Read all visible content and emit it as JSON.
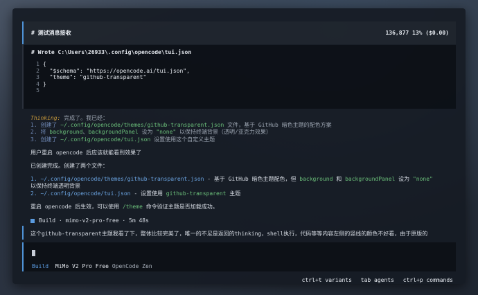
{
  "header": {
    "title": "# 测试消息接收",
    "stats": "136,877  13% ($0.00)"
  },
  "tool": {
    "title": "# Wrote C:\\Users\\26933\\.config\\opencode\\tui.json",
    "lines": [
      {
        "num": "1",
        "text": "{"
      },
      {
        "num": "2",
        "text": "  \"$schema\": \"https://opencode.ai/tui.json\","
      },
      {
        "num": "3",
        "text": "  \"theme\": \"github-transparent\""
      },
      {
        "num": "4",
        "text": "}"
      },
      {
        "num": "5",
        "text": ""
      }
    ]
  },
  "thinking": {
    "label": "Thinking:",
    "intro": " 完成了。我已经：",
    "l1_num": "1. 创建了 ",
    "l1_path": "~/.config/opencode/themes/github-transparent.json",
    "l1_rest": " 文件，基于 GitHub 暗色主题的配色方案",
    "l2_num": "2. 将 ",
    "l2_a": "background",
    "l2_sep": "、",
    "l2_b": "backgroundPanel",
    "l2_mid": " 设为 ",
    "l2_none": "\"none\"",
    "l2_rest": " 以保持终端背景（透明/亚克力效果）",
    "l3_num": "3. 创建了 ",
    "l3_path": "~/.config/opencode/tui.json",
    "l3_rest": " 设置使用这个自定义主题"
  },
  "body": {
    "restart_hint": "用户重启 opencode 后应该就能看到效果了",
    "created": "已创建完成。创建了两个文件：",
    "item1_num": "1. ",
    "item1_path": "~/.config/opencode/themes/github-transparent.json",
    "item1_mid": " - 基于 GitHub 暗色主题配色，但 ",
    "item1_bg": "background",
    "item1_and": " 和 ",
    "item1_bgp": "backgroundPanel",
    "item1_set": " 设为 ",
    "item1_none": "\"none\"",
    "item1_cont": "以保持终端透明背景",
    "item2_num": "2. ",
    "item2_path": "~/.config/opencode/tui.json",
    "item2_mid": " - 设置使用 ",
    "item2_theme": "github-transparent",
    "item2_end": " 主题",
    "restart_a": "重启 opencode 后生效，可以使用 ",
    "restart_cmd": "/theme",
    "restart_b": " 命令验证主题是否加载成功。",
    "build_label": "Build · mimo-v2-pro-free · 5m 48s"
  },
  "user_message": "这个github-transparent主题我看了下，整体比较完美了，唯一的不足是返回的thinking，shell执行，代码等等内容左侧的竖线的颜色不好看，由于原版的",
  "input": {
    "mode": "Build",
    "model": "MiMo V2 Pro Free",
    "provider": "OpenCode Zen"
  },
  "footer": {
    "variants": "ctrl+t variants",
    "agents": "tab agents",
    "commands": "ctrl+p commands"
  },
  "colors": {
    "accent": "#4f93d8",
    "thinking_label": "#c89a3a",
    "path": "#6bbf7a"
  }
}
